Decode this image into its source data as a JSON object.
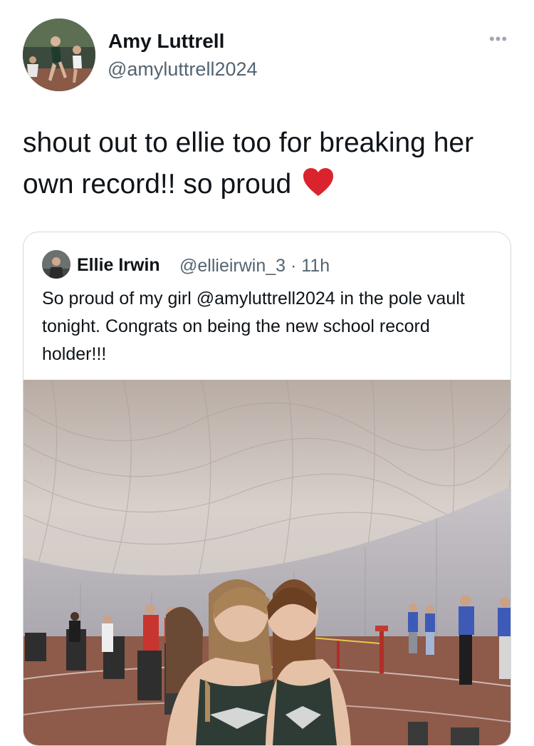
{
  "tweet": {
    "author_name": "Amy Luttrell",
    "author_handle": "@amyluttrell2024",
    "text": "shout out to ellie too for breaking her own record!! so proud",
    "more_label": "•••",
    "heart_icon": "red-heart-emoji"
  },
  "quoted_tweet": {
    "author_name": "Ellie Irwin",
    "meta": "@ellieirwin_3 · 11h",
    "text": "So proud of my girl @amyluttrell2024 in the pole vault tonight. Congrats on being the new school record holder!!!",
    "photo": "two-athletes-indoor-track-dome"
  },
  "colors": {
    "text": "#0f1419",
    "secondary": "#536471",
    "border": "#cfd9de",
    "heart": "#d9232d"
  }
}
